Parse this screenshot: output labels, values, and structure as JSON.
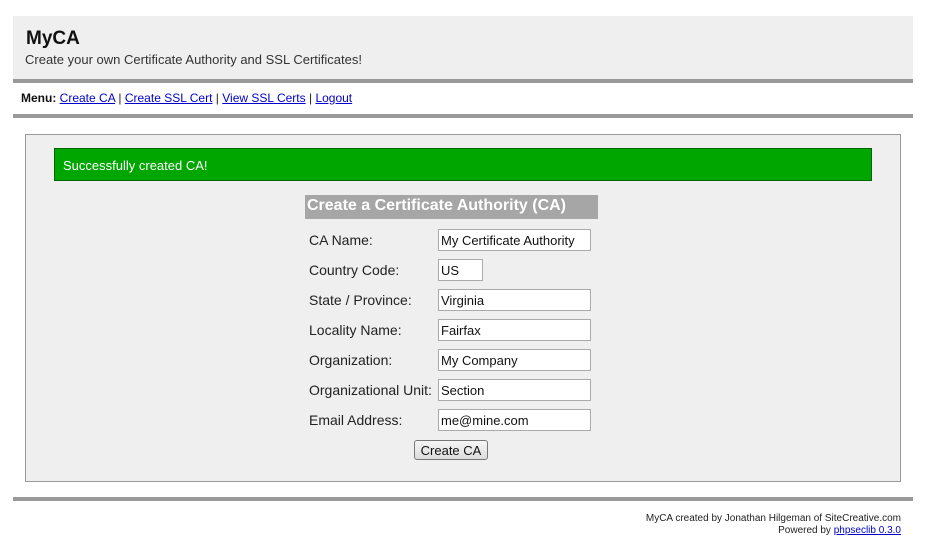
{
  "header": {
    "title": "MyCA",
    "tagline": "Create your own Certificate Authority and SSL Certificates!"
  },
  "menu": {
    "label": "Menu:",
    "items": [
      {
        "label": "Create CA"
      },
      {
        "label": "Create SSL Cert"
      },
      {
        "label": "View SSL Certs"
      },
      {
        "label": "Logout"
      }
    ],
    "separator": "|"
  },
  "alert": {
    "message": "Successfully created CA!",
    "color": "#00a600"
  },
  "form": {
    "title": "Create a Certificate Authority (CA)",
    "fields": [
      {
        "label": "CA Name:",
        "value": "My Certificate Authority"
      },
      {
        "label": "Country Code:",
        "value": "US"
      },
      {
        "label": "State / Province:",
        "value": "Virginia"
      },
      {
        "label": "Locality Name:",
        "value": "Fairfax"
      },
      {
        "label": "Organization:",
        "value": "My Company"
      },
      {
        "label": "Organizational Unit:",
        "value": "Section"
      },
      {
        "label": "Email Address:",
        "value": "me@mine.com"
      }
    ],
    "submit_label": "Create CA"
  },
  "footer": {
    "credit": "MyCA created by Jonathan Hilgeman of SiteCreative.com",
    "powered_prefix": "Powered by ",
    "powered_link": "phpseclib 0.3.0"
  }
}
